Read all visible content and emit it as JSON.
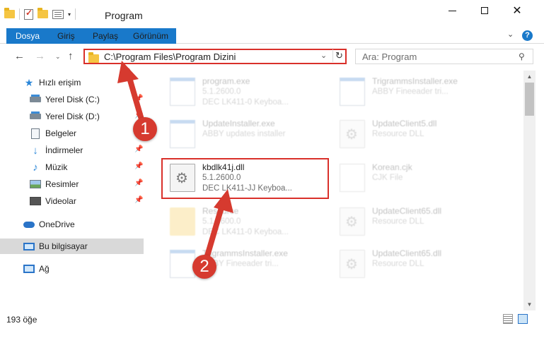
{
  "window": {
    "title": "Program",
    "controls": [
      "minimize",
      "maximize",
      "close"
    ]
  },
  "ribbon": {
    "tabs": [
      {
        "label": "Dosya",
        "active": true
      },
      {
        "label": "Giriş"
      },
      {
        "label": "Paylaş"
      },
      {
        "label": "Görünüm"
      }
    ],
    "help": "?",
    "expand": "⌄"
  },
  "nav": {
    "back": "←",
    "forward": "→",
    "recent": "⌄",
    "up": "↑",
    "address_path": "C:\\Program Files\\Program Dizini",
    "address_dropdown": "⌄",
    "refresh": "↻",
    "search_placeholder": "Ara: Program",
    "search_icon": "⚲"
  },
  "sidebar": {
    "items": [
      {
        "label": "Hızlı erişim",
        "icon": "star-icon"
      },
      {
        "label": "Yerel Disk (C:)",
        "icon": "drive-icon",
        "pinned": true
      },
      {
        "label": "Yerel Disk (D:)",
        "icon": "drive-icon",
        "pinned": true
      },
      {
        "label": "Belgeler",
        "icon": "documents-icon",
        "pinned": true
      },
      {
        "label": "İndirmeler",
        "icon": "downloads-icon",
        "pinned": true
      },
      {
        "label": "Müzik",
        "icon": "music-icon",
        "pinned": true
      },
      {
        "label": "Resimler",
        "icon": "pictures-icon",
        "pinned": true
      },
      {
        "label": "Videolar",
        "icon": "videos-icon",
        "pinned": true
      },
      {
        "label": "OneDrive",
        "icon": "onedrive-icon"
      },
      {
        "label": "Bu bilgisayar",
        "icon": "this-pc-icon",
        "selected": true
      },
      {
        "label": "Ağ",
        "icon": "network-icon"
      }
    ]
  },
  "files": [
    {
      "name": "program.exe",
      "version": "5.1.2600.0",
      "desc": "DEC LK411-0 Keyboa...",
      "type": "exe",
      "faded": true
    },
    {
      "name": "TrigrammsInstaller.exe",
      "version": "ABBY Fineeader tri...",
      "desc": "",
      "type": "exe",
      "faded": true
    },
    {
      "name": "UpdateInstaller.exe",
      "version": "ABBY updates installer",
      "desc": "",
      "type": "exe",
      "faded": true
    },
    {
      "name": "UpdateClient5.dll",
      "version": "Resource DLL",
      "desc": "",
      "type": "dll",
      "faded": true
    },
    {
      "name": "kbdlk41j.dll",
      "version": "5.1.2600.0",
      "desc": "DEC LK411-JJ Keyboa...",
      "type": "dll",
      "faded": false,
      "highlighted": true
    },
    {
      "name": "Korean.cjk",
      "version": "CJK File",
      "desc": "",
      "type": "cjk",
      "faded": true
    },
    {
      "name": "Resource",
      "version": "5.1.2600.0",
      "desc": "DEC LK411-0 Keyboa...",
      "type": "folder",
      "faded": true
    },
    {
      "name": "UpdateClient65.dll",
      "version": "Resource DLL",
      "desc": "",
      "type": "dll",
      "faded": true
    },
    {
      "name": "TrigrammsInstaller.exe",
      "version": "ABBY Fineeader tri...",
      "desc": "",
      "type": "exe",
      "faded": true
    },
    {
      "name": "UpdateClient65.dll",
      "version": "Resource DLL",
      "desc": "",
      "type": "dll",
      "faded": true
    }
  ],
  "status": {
    "count": "193 öğe"
  },
  "annotations": {
    "badge1": "1",
    "badge2": "2",
    "color": "#d63a2f"
  }
}
